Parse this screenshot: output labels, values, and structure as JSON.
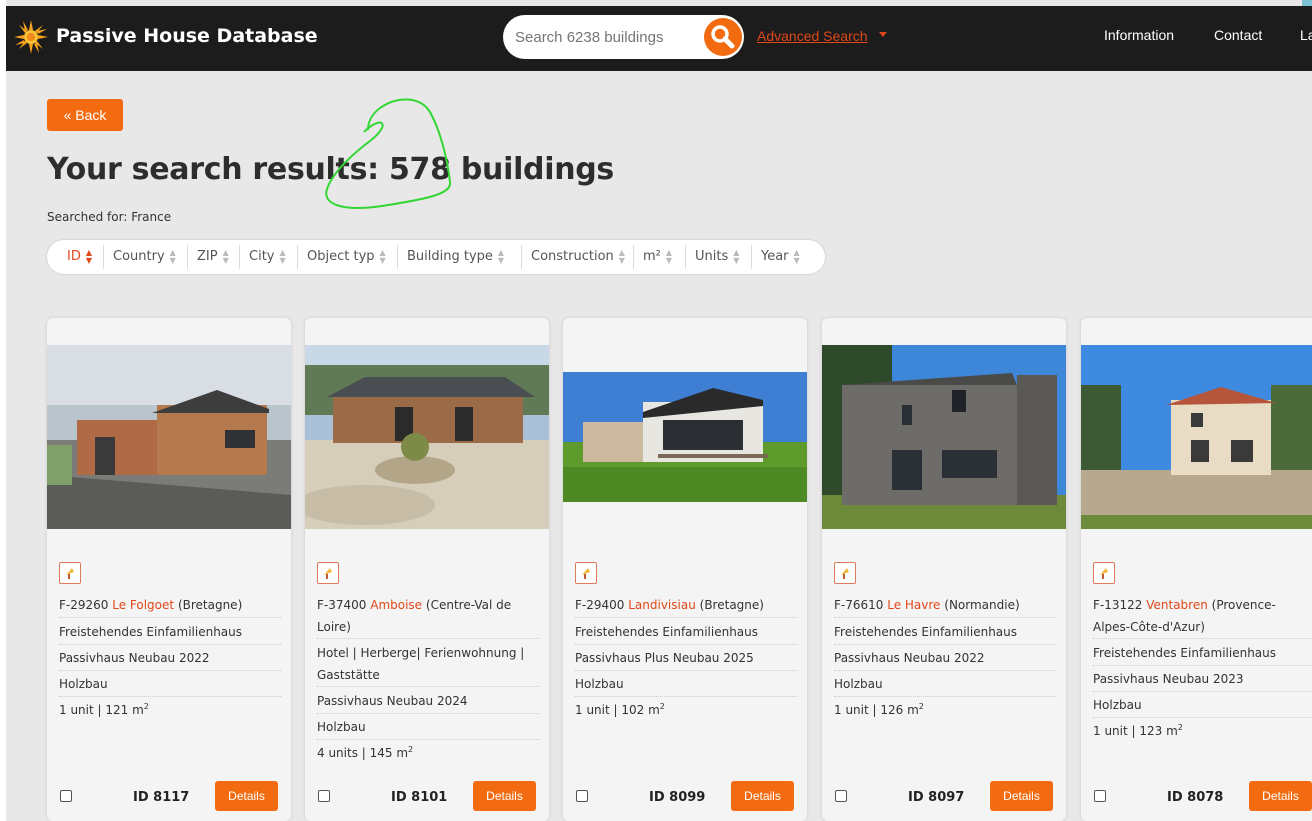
{
  "header": {
    "brand": "Passive House Database",
    "search_placeholder": "Search 6238 buildings",
    "advanced_search": "Advanced Search",
    "nav": [
      "Information",
      "Contact",
      "La"
    ]
  },
  "back_label": "« Back",
  "results_title": "Your search results: 578 buildings",
  "searched_for": "Searched for: France",
  "sort_columns": [
    "ID",
    "Country",
    "ZIP",
    "City",
    "Object typ",
    "Building type",
    "Construction",
    "m²",
    "Units",
    "Year"
  ],
  "details_label": "Details",
  "cards": [
    {
      "zip": "F-29260",
      "city": "Le Folgoet",
      "region": "(Bretagne)",
      "type": "Freistehendes Einfamilienhaus",
      "standard": "Passivhaus Neubau 2022",
      "construction": "Holzbau",
      "units": "1 unit | 121 m",
      "sup": "2",
      "id": "ID 8117"
    },
    {
      "zip": "F-37400",
      "city": "Amboise",
      "region": "(Centre-Val de",
      "region2": "Loire)",
      "type": "Hotel | Herberge| Ferienwohnung |",
      "type2": "Gaststätte",
      "standard": "Passivhaus Neubau 2024",
      "construction": "Holzbau",
      "units": "4 units | 145 m",
      "sup": "2",
      "id": "ID 8101"
    },
    {
      "zip": "F-29400",
      "city": "Landivisiau",
      "region": "(Bretagne)",
      "type": "Freistehendes Einfamilienhaus",
      "standard": "Passivhaus Plus Neubau 2025",
      "construction": "Holzbau",
      "units": "1 unit | 102 m",
      "sup": "2",
      "id": "ID 8099"
    },
    {
      "zip": "F-76610",
      "city": "Le Havre",
      "region": "(Normandie)",
      "type": "Freistehendes Einfamilienhaus",
      "standard": "Passivhaus Neubau 2022",
      "construction": "Holzbau",
      "units": "1 unit | 126 m",
      "sup": "2",
      "id": "ID 8097"
    },
    {
      "zip": "F-13122",
      "city": "Ventabren",
      "region": "(Provence-",
      "region2": "Alpes-Côte-d'Azur)",
      "type": "Freistehendes Einfamilienhaus",
      "standard": "Passivhaus Neubau 2023",
      "construction": "Holzbau",
      "units": "1 unit | 123 m",
      "sup": "2",
      "id": "ID 8078"
    }
  ],
  "colors": {
    "accent": "#f26b10",
    "link": "#e0481a",
    "header_bg": "#1c1c1c",
    "page_bg": "#e8e8e8"
  }
}
